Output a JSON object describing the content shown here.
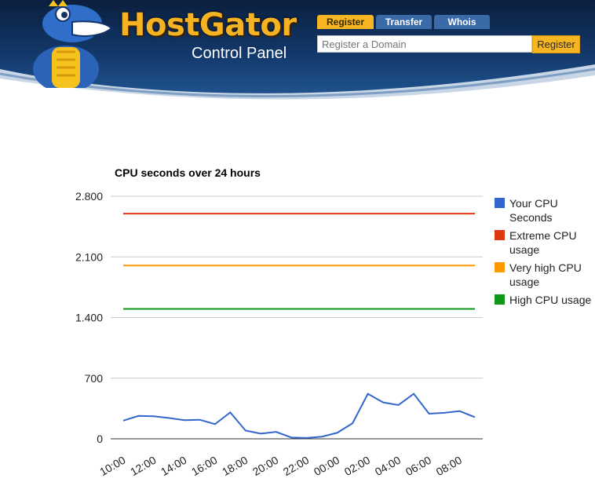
{
  "header": {
    "brand_name": "HostGator",
    "brand_subtitle": "Control Panel",
    "tabs": [
      {
        "label": "Register",
        "active": true
      },
      {
        "label": "Transfer",
        "active": false
      },
      {
        "label": "Whois",
        "active": false
      }
    ],
    "domain_placeholder": "Register a Domain",
    "register_button": "Register",
    "colors": {
      "accent": "#f6b521",
      "header_bg": "#123768"
    }
  },
  "chart_data": {
    "type": "line",
    "title": "CPU seconds over 24 hours",
    "xlabel": "",
    "ylabel": "",
    "ylim": [
      0,
      2800
    ],
    "yticks": [
      0,
      700,
      1400,
      2100,
      2800
    ],
    "ytick_labels": [
      "0",
      "700",
      "1.400",
      "2.100",
      "2.800"
    ],
    "xtick_labels": [
      "10:00",
      "12:00",
      "14:00",
      "16:00",
      "18:00",
      "20:00",
      "22:00",
      "00:00",
      "02:00",
      "04:00",
      "06:00",
      "08:00"
    ],
    "grid": true,
    "legend_position": "right",
    "series": [
      {
        "name": "Your CPU Seconds",
        "color": "#3366cc",
        "values": [
          210,
          265,
          260,
          240,
          215,
          220,
          170,
          305,
          95,
          60,
          80,
          15,
          10,
          25,
          70,
          180,
          520,
          420,
          390,
          520,
          290,
          300,
          320,
          250
        ]
      },
      {
        "name": "Extreme CPU usage",
        "color": "#dc3912",
        "values": [
          2600,
          2600,
          2600,
          2600,
          2600,
          2600,
          2600,
          2600,
          2600,
          2600,
          2600,
          2600,
          2600,
          2600,
          2600,
          2600,
          2600,
          2600,
          2600,
          2600,
          2600,
          2600,
          2600,
          2600
        ]
      },
      {
        "name": "Very high CPU usage",
        "color": "#ff9900",
        "values": [
          2000,
          2000,
          2000,
          2000,
          2000,
          2000,
          2000,
          2000,
          2000,
          2000,
          2000,
          2000,
          2000,
          2000,
          2000,
          2000,
          2000,
          2000,
          2000,
          2000,
          2000,
          2000,
          2000,
          2000
        ]
      },
      {
        "name": "High CPU usage",
        "color": "#109618",
        "values": [
          1500,
          1500,
          1500,
          1500,
          1500,
          1500,
          1500,
          1500,
          1500,
          1500,
          1500,
          1500,
          1500,
          1500,
          1500,
          1500,
          1500,
          1500,
          1500,
          1500,
          1500,
          1500,
          1500,
          1500
        ]
      }
    ]
  }
}
